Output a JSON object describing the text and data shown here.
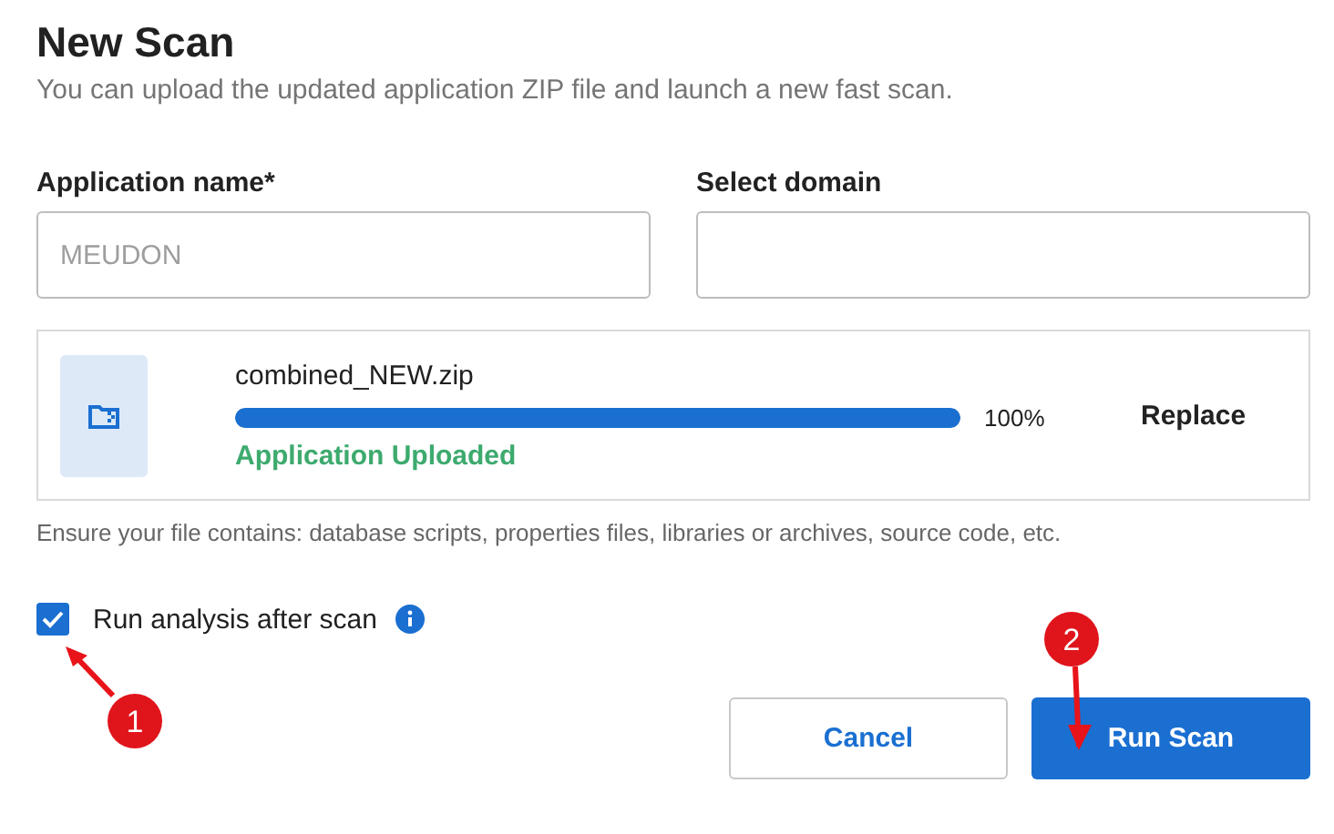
{
  "title": "New Scan",
  "subtitle": "You can upload the updated application ZIP file and launch a new fast scan.",
  "fields": [
    {
      "label": "Application name*",
      "placeholder": "MEUDON"
    },
    {
      "label": "Select domain"
    }
  ],
  "upload": {
    "file_name": "combined_NEW.zip",
    "level": 1,
    "percent": "100%",
    "status": "Application Uploaded",
    "action": "Replace"
  },
  "hint": "Ensure your file contains: database scripts, properties files, libraries or archives, source code, etc.",
  "run_analysis": {
    "label": "Run analysis after scan",
    "checked": true
  },
  "buttons": [
    {
      "label": "Cancel",
      "kind": "secondary"
    },
    {
      "label": "Run Scan",
      "kind": "primary"
    }
  ],
  "annotations": [
    {
      "number": "1"
    },
    {
      "number": "2"
    }
  ]
}
